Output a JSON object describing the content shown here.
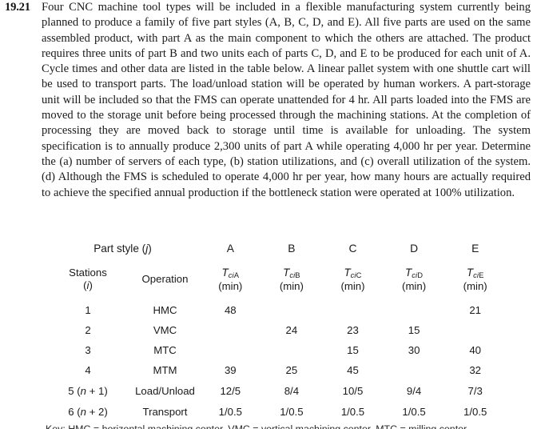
{
  "problem": {
    "number": "19.21",
    "text": "Four CNC machine tool types will be included in a flexible manufacturing system currently being planned to produce a family of five part styles (A, B, C, D, and E). All five parts are used on the same assembled product, with part A as the main component to which the others are attached. The product requires three units of part B and two units each of parts C, D, and E to be produced for each unit of A. Cycle times and other data are listed in the table below. A linear pallet system with one shuttle cart will be used to transport parts. The load/unload station will be operated by human workers. A part-storage unit will be included so that the FMS can operate unattended for 4 hr. All parts loaded into the FMS are moved to the storage unit before being processed through the machining stations. At the completion of processing they are moved back to storage until time is available for unloading. The system specification is to annually produce 2,300 units of part A while operating 4,000 hr per year. Determine the (a) number of servers of each type, (b) station utilizations, and (c) overall utilization of the system. (d) Although the FMS is scheduled to operate 4,000 hr per year, how many hours are actually required to achieve the specified annual production if the bottleneck station were operated at 100% utilization."
  },
  "table": {
    "group_header": {
      "label_prefix": "Part style (",
      "label_symbol": "j",
      "label_suffix": ")"
    },
    "part_styles": [
      "A",
      "B",
      "C",
      "D",
      "E"
    ],
    "subheaders": {
      "stations_label": "Stations",
      "stations_index_open": "(",
      "stations_index_symbol": "i",
      "stations_index_close": ")",
      "operation_label": "Operation",
      "unit_label": "(min)",
      "symbol_base": "T",
      "symbol_sub_italic": "ci",
      "symbol_sub_parts": [
        "A",
        "B",
        "C",
        "D",
        "E"
      ]
    },
    "rows": [
      {
        "station": "1",
        "station_paren": "",
        "operation": "HMC",
        "values": [
          "48",
          "",
          "",
          "",
          "21"
        ]
      },
      {
        "station": "2",
        "station_paren": "",
        "operation": "VMC",
        "values": [
          "",
          "24",
          "23",
          "15",
          ""
        ]
      },
      {
        "station": "3",
        "station_paren": "",
        "operation": "MTC",
        "values": [
          "",
          "",
          "15",
          "30",
          "40"
        ]
      },
      {
        "station": "4",
        "station_paren": "",
        "operation": "MTM",
        "values": [
          "39",
          "25",
          "45",
          "",
          "32"
        ]
      },
      {
        "station": "5",
        "station_paren": "(n + 1)",
        "station_paren_open": "(",
        "station_paren_symbol": "n",
        "station_paren_close": " + 1)",
        "operation": "Load/Unload",
        "values": [
          "12/5",
          "8/4",
          "10/5",
          "9/4",
          "7/3"
        ]
      },
      {
        "station": "6",
        "station_paren": "(n + 2)",
        "station_paren_open": "(",
        "station_paren_symbol": "n",
        "station_paren_close": " + 2)",
        "operation": "Transport",
        "values": [
          "1/0.5",
          "1/0.5",
          "1/0.5",
          "1/0.5",
          "1/0.5"
        ]
      }
    ]
  },
  "footnote": {
    "text": "Key: HMC = horizontal machining center, VMC = vertical machining center, MTC = milling center"
  }
}
